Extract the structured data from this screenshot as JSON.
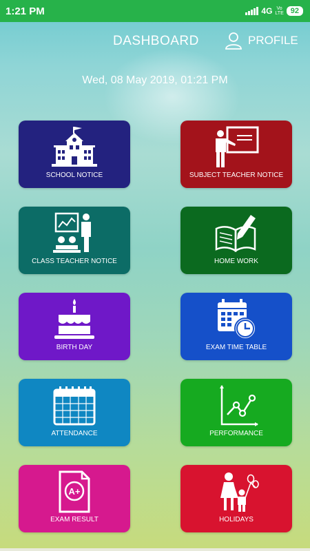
{
  "status": {
    "time": "1:21 PM",
    "network": "4G",
    "volte": [
      "Vo",
      "LTE"
    ],
    "battery": "92"
  },
  "header": {
    "title": "DASHBOARD",
    "profile_label": "PROFILE"
  },
  "datetime": "Wed, 08 May 2019, 01:21 PM",
  "tiles": [
    {
      "label": "SCHOOL NOTICE",
      "color": "#23227f",
      "icon": "school-building-icon"
    },
    {
      "label": "SUBJECT TEACHER NOTICE",
      "color": "#a3131b",
      "icon": "teacher-board-icon"
    },
    {
      "label": "CLASS TEACHER NOTICE",
      "color": "#0c6c66",
      "icon": "classroom-icon"
    },
    {
      "label": "HOME WORK",
      "color": "#0b6a1f",
      "icon": "book-pencil-icon"
    },
    {
      "label": "BIRTH DAY",
      "color": "#6f18c8",
      "icon": "birthday-cake-icon"
    },
    {
      "label": "EXAM TIME TABLE",
      "color": "#1550c9",
      "icon": "calendar-clock-icon"
    },
    {
      "label": "ATTENDANCE",
      "color": "#0f87c2",
      "icon": "calendar-icon"
    },
    {
      "label": "PERFORMANCE",
      "color": "#16aa20",
      "icon": "line-chart-icon"
    },
    {
      "label": "EXAM RESULT",
      "color": "#d6198e",
      "icon": "grade-document-icon"
    },
    {
      "label": "HOLIDAYS",
      "color": "#d8132f",
      "icon": "family-balloon-icon"
    }
  ]
}
